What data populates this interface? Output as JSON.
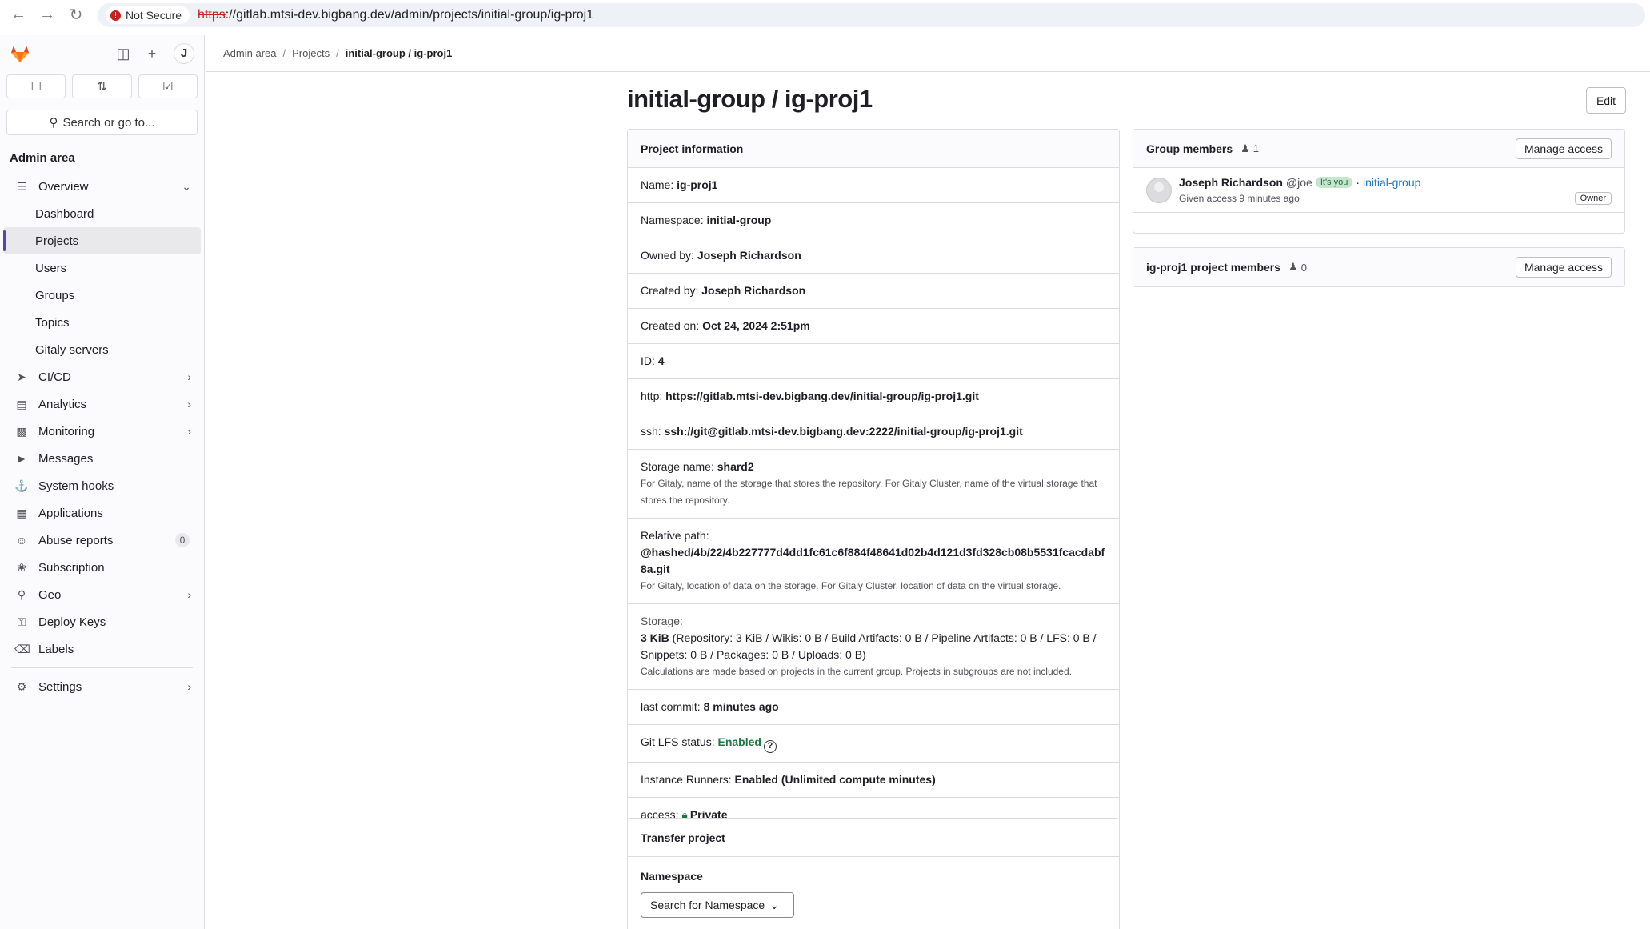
{
  "browser": {
    "security_label": "Not Secure",
    "url_scheme": "https",
    "url_rest": "://gitlab.mtsi-dev.bigbang.dev/admin/projects/initial-group/ig-proj1"
  },
  "sidebar": {
    "avatar_letter": "J",
    "search_label": "Search or go to...",
    "section_title": "Admin area",
    "overview_label": "Overview",
    "overview_children": [
      "Dashboard",
      "Projects",
      "Users",
      "Groups",
      "Topics",
      "Gitaly servers"
    ],
    "items": [
      {
        "label": "CI/CD",
        "icon": "rocket-icon"
      },
      {
        "label": "Analytics",
        "icon": "chart-icon"
      },
      {
        "label": "Monitoring",
        "icon": "monitor-icon"
      },
      {
        "label": "Messages",
        "icon": "bullhorn-icon"
      },
      {
        "label": "System hooks",
        "icon": "anchor-icon"
      },
      {
        "label": "Applications",
        "icon": "apps-icon"
      },
      {
        "label": "Abuse reports",
        "icon": "abuse-icon",
        "badge": "0"
      },
      {
        "label": "Subscription",
        "icon": "license-icon"
      },
      {
        "label": "Geo",
        "icon": "location-icon"
      },
      {
        "label": "Deploy Keys",
        "icon": "key-icon"
      },
      {
        "label": "Labels",
        "icon": "label-icon"
      },
      {
        "label": "Settings",
        "icon": "gear-icon"
      }
    ]
  },
  "breadcrumb": {
    "items": [
      "Admin area",
      "Projects"
    ],
    "current": "initial-group / ig-proj1"
  },
  "page": {
    "title": "initial-group / ig-proj1",
    "edit_label": "Edit"
  },
  "project_info": {
    "header": "Project information",
    "name_label": "Name:",
    "name": "ig-proj1",
    "namespace_label": "Namespace:",
    "namespace": "initial-group",
    "owned_label": "Owned by:",
    "owned": "Joseph Richardson",
    "created_by_label": "Created by:",
    "created_by": "Joseph Richardson",
    "created_on_label": "Created on:",
    "created_on": "Oct 24, 2024 2:51pm",
    "id_label": "ID:",
    "id": "4",
    "http_label": "http:",
    "http": "https://gitlab.mtsi-dev.bigbang.dev/initial-group/ig-proj1.git",
    "ssh_label": "ssh:",
    "ssh": "ssh://git@gitlab.mtsi-dev.bigbang.dev:2222/initial-group/ig-proj1.git",
    "storage_name_label": "Storage name:",
    "storage_name": "shard2",
    "storage_name_help": "For Gitaly, name of the storage that stores the repository. For Gitaly Cluster, name of the virtual storage that stores the repository.",
    "relative_path_label": "Relative path:",
    "relative_path": "@hashed/4b/22/4b227777d4dd1fc61c6f884f48641d02b4d121d3fd328cb08b5531fcacdabf8a.git",
    "relative_path_help": "For Gitaly, location of data on the storage. For Gitaly Cluster, location of data on the virtual storage.",
    "storage_label": "Storage:",
    "storage_total": "3 KiB",
    "storage_detail": " (Repository: 3 KiB / Wikis: 0 B / Build Artifacts: 0 B / Pipeline Artifacts: 0 B / LFS: 0 B / Snippets: 0 B / Packages: 0 B / Uploads: 0 B)",
    "storage_help": "Calculations are made based on projects in the current group. Projects in subgroups are not included.",
    "last_commit_label": "last commit:",
    "last_commit": "8 minutes ago",
    "lfs_label": "Git LFS status:",
    "lfs": "Enabled",
    "runners_label": "Instance Runners:",
    "runners": "Enabled (Unlimited compute minutes)",
    "access_label": "access:",
    "access": "Private"
  },
  "group_members": {
    "title": "Group members",
    "count": "1",
    "manage_label": "Manage access",
    "member": {
      "name": "Joseph Richardson",
      "handle": "@joe",
      "its_you": "It's you",
      "separator": "·",
      "group": "initial-group",
      "given": "Given access 9 minutes ago",
      "role": "Owner"
    }
  },
  "project_members": {
    "title": "ig-proj1 project members",
    "count": "0",
    "manage_label": "Manage access"
  },
  "transfer": {
    "header": "Transfer project",
    "namespace_label": "Namespace",
    "dropdown_label": "Search for Namespace"
  }
}
